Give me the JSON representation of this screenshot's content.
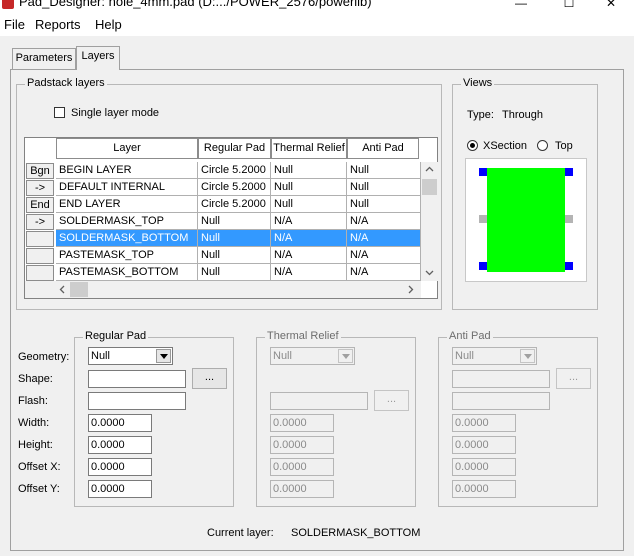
{
  "window": {
    "title": "Pad_Designer: hole_4mm.pad (D:.../POWER_2576/powerlib)",
    "minimize_glyph": "—",
    "maximize_glyph": "☐",
    "close_glyph": "✕"
  },
  "menu": [
    "File",
    "Reports",
    "Help"
  ],
  "tabs": [
    "Parameters",
    "Layers"
  ],
  "active_tab": "Layers",
  "padstack": {
    "group_label": "Padstack layers",
    "single_layer_mode_label": "Single layer mode",
    "single_layer_mode_checked": false,
    "columns": [
      "Layer",
      "Regular Pad",
      "Thermal Relief",
      "Anti Pad"
    ],
    "row_buttons": [
      "Bgn",
      "->",
      "End",
      "->",
      "",
      "",
      ""
    ],
    "rows": [
      {
        "layer": "BEGIN LAYER",
        "regular": "Circle 5.2000",
        "thermal": "Null",
        "anti": "Null"
      },
      {
        "layer": "DEFAULT INTERNAL",
        "regular": "Circle 5.2000",
        "thermal": "Null",
        "anti": "Null"
      },
      {
        "layer": "END LAYER",
        "regular": "Circle 5.2000",
        "thermal": "Null",
        "anti": "Null"
      },
      {
        "layer": "SOLDERMASK_TOP",
        "regular": "Null",
        "thermal": "N/A",
        "anti": "N/A"
      },
      {
        "layer": "SOLDERMASK_BOTTOM",
        "regular": "Null",
        "thermal": "N/A",
        "anti": "N/A"
      },
      {
        "layer": "PASTEMASK_TOP",
        "regular": "Null",
        "thermal": "N/A",
        "anti": "N/A"
      },
      {
        "layer": "PASTEMASK_BOTTOM",
        "regular": "Null",
        "thermal": "N/A",
        "anti": "N/A"
      }
    ],
    "selected_row": 4
  },
  "views": {
    "group_label": "Views",
    "type_label": "Type:",
    "type_value": "Through",
    "xsection_label": "XSection",
    "top_label": "Top",
    "selected": "XSection",
    "pad_color": "#00ff00",
    "marker_color": "#0000ff"
  },
  "field_labels": [
    "Geometry:",
    "Shape:",
    "Flash:",
    "Width:",
    "Height:",
    "Offset X:",
    "Offset Y:"
  ],
  "regular_pad": {
    "label": "Regular Pad",
    "geometry": "Null",
    "shape": "",
    "flash": "",
    "width": "0.0000",
    "height": "0.0000",
    "offset_x": "0.0000",
    "offset_y": "0.0000"
  },
  "thermal_relief": {
    "label": "Thermal Relief",
    "geometry": "Null",
    "width": "0.0000",
    "height": "0.0000",
    "offset_x": "0.0000",
    "offset_y": "0.0000"
  },
  "anti_pad": {
    "label": "Anti Pad",
    "geometry": "Null",
    "width": "0.0000",
    "height": "0.0000",
    "offset_x": "0.0000",
    "offset_y": "0.0000"
  },
  "browse_label": "...",
  "current_layer_label": "Current layer:",
  "current_layer_value": "SOLDERMASK_BOTTOM"
}
